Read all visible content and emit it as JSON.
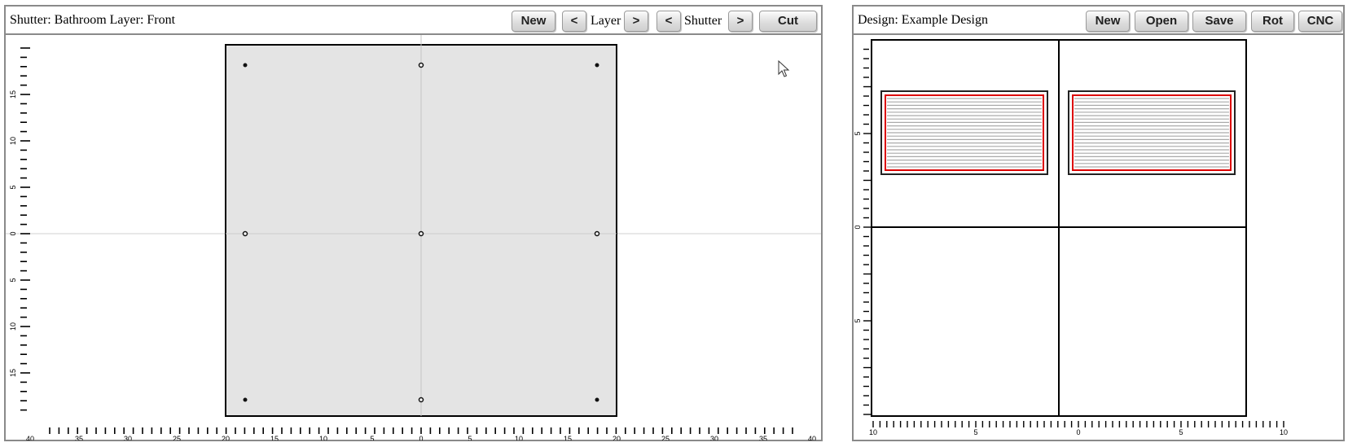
{
  "left_panel": {
    "title": "Shutter: Bathroom Layer: Front",
    "buttons": {
      "new": "New",
      "layer_prev": "<",
      "layer_label": "Layer",
      "layer_next": ">",
      "shutter_prev": "<",
      "shutter_label": "Shutter",
      "shutter_next": ">",
      "cut": "Cut"
    },
    "y_axis_labels": [
      "15",
      "10",
      "5",
      "0",
      "5",
      "10",
      "15"
    ],
    "x_axis_labels": [
      "40",
      "35",
      "30",
      "25",
      "20",
      "15",
      "10",
      "5",
      "0",
      "5",
      "10",
      "15",
      "20",
      "25",
      "30",
      "35",
      "40"
    ]
  },
  "right_panel": {
    "title": "Design: Example Design",
    "buttons": {
      "new": "New",
      "open": "Open",
      "save": "Save",
      "rot": "Rot",
      "cnc": "CNC"
    },
    "y_axis_labels": [
      "5",
      "0",
      "5"
    ],
    "x_axis_labels": [
      "10",
      "5",
      "0",
      "5",
      "10"
    ]
  },
  "colors": {
    "panel_border": "#8a8a8a",
    "shutter_fill": "#e4e4e4",
    "louver_line": "#aaaaaa",
    "cut_outline": "#dd0000"
  }
}
